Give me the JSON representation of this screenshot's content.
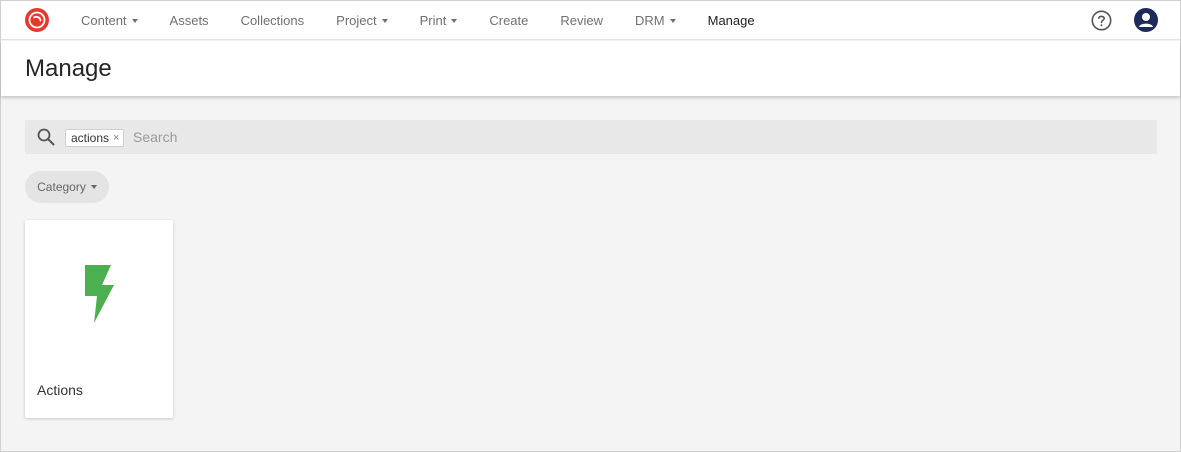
{
  "nav": {
    "items": [
      {
        "label": "Content",
        "dropdown": true
      },
      {
        "label": "Assets",
        "dropdown": false
      },
      {
        "label": "Collections",
        "dropdown": false
      },
      {
        "label": "Project",
        "dropdown": true
      },
      {
        "label": "Print",
        "dropdown": true
      },
      {
        "label": "Create",
        "dropdown": false
      },
      {
        "label": "Review",
        "dropdown": false
      },
      {
        "label": "DRM",
        "dropdown": true
      },
      {
        "label": "Manage",
        "dropdown": false,
        "active": true
      }
    ],
    "logo_icon": "sitecore-logo-icon",
    "help_icon": "help-circle-icon",
    "avatar_icon": "user-avatar-icon"
  },
  "header": {
    "title": "Manage"
  },
  "search": {
    "tag": "actions",
    "tag_remove": "×",
    "placeholder": "Search",
    "value": ""
  },
  "filters": {
    "category_label": "Category"
  },
  "cards": [
    {
      "label": "Actions",
      "icon": "lightning-bolt-icon",
      "icon_color": "#4caf50"
    }
  ],
  "colors": {
    "accent": "#e8382c",
    "avatar": "#1e2a5a",
    "bolt": "#4caf50"
  }
}
